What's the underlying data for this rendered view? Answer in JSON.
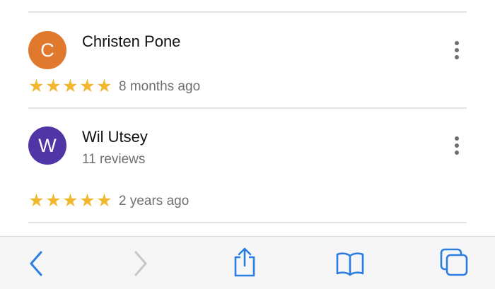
{
  "reviews": [
    {
      "avatar_letter": "C",
      "avatar_color": "#e0782d",
      "name": "Christen Pone",
      "review_count": "",
      "rating": 5,
      "time_ago": "8 months ago"
    },
    {
      "avatar_letter": "W",
      "avatar_color": "#4f35a6",
      "name": "Wil Utsey",
      "review_count": "11 reviews",
      "rating": 5,
      "time_ago": "2 years ago"
    }
  ],
  "colors": {
    "star": "#f1b72d",
    "toolbar_icon_active": "#2a7de1",
    "toolbar_icon_disabled": "#c7c7c7"
  },
  "toolbar": {
    "icons": [
      "back-icon",
      "forward-icon",
      "share-icon",
      "bookmarks-icon",
      "tabs-icon"
    ]
  }
}
